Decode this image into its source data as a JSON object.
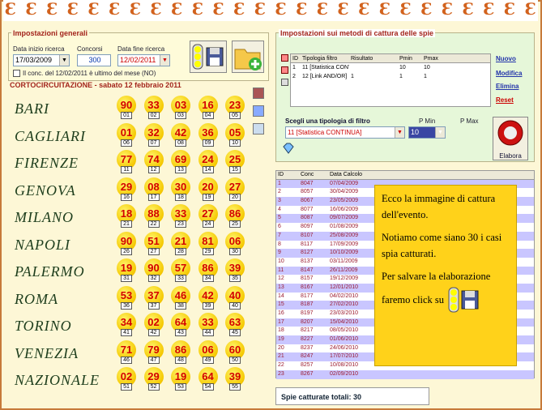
{
  "general": {
    "title": "Impostazioni generali",
    "start_label": "Data inizio ricerca",
    "start_value": "17/03/2009",
    "contests_label": "Concorsi",
    "contests_value": "300",
    "end_label": "Data fine ricerca",
    "end_value": "12/02/2011",
    "checkbox_label": "Il conc. del 12/02/2011 è ultimo del mese (NO)"
  },
  "lotto": {
    "title": "CORTOCIRCUITAZIONE - sabato 12 febbraio 2011",
    "rows": [
      {
        "city": "BARI",
        "nums": [
          "90",
          "33",
          "03",
          "16",
          "23"
        ],
        "idx": [
          "01",
          "02",
          "03",
          "04",
          "05"
        ]
      },
      {
        "city": "CAGLIARI",
        "nums": [
          "01",
          "32",
          "42",
          "36",
          "05"
        ],
        "idx": [
          "06",
          "07",
          "08",
          "09",
          "10"
        ]
      },
      {
        "city": "FIRENZE",
        "nums": [
          "77",
          "74",
          "69",
          "24",
          "25"
        ],
        "idx": [
          "11",
          "12",
          "13",
          "14",
          "15"
        ]
      },
      {
        "city": "GENOVA",
        "nums": [
          "29",
          "08",
          "30",
          "20",
          "27"
        ],
        "idx": [
          "16",
          "17",
          "18",
          "19",
          "20"
        ]
      },
      {
        "city": "MILANO",
        "nums": [
          "18",
          "88",
          "33",
          "27",
          "86"
        ],
        "idx": [
          "21",
          "22",
          "23",
          "24",
          "25"
        ]
      },
      {
        "city": "NAPOLI",
        "nums": [
          "90",
          "51",
          "21",
          "81",
          "06"
        ],
        "idx": [
          "26",
          "27",
          "28",
          "29",
          "30"
        ]
      },
      {
        "city": "PALERMO",
        "nums": [
          "19",
          "90",
          "57",
          "86",
          "39"
        ],
        "idx": [
          "31",
          "32",
          "33",
          "34",
          "35"
        ]
      },
      {
        "city": "ROMA",
        "nums": [
          "53",
          "37",
          "46",
          "42",
          "40"
        ],
        "idx": [
          "36",
          "37",
          "38",
          "39",
          "40"
        ]
      },
      {
        "city": "TORINO",
        "nums": [
          "34",
          "02",
          "64",
          "33",
          "63"
        ],
        "idx": [
          "41",
          "42",
          "43",
          "44",
          "45"
        ]
      },
      {
        "city": "VENEZIA",
        "nums": [
          "71",
          "79",
          "86",
          "06",
          "60"
        ],
        "idx": [
          "46",
          "47",
          "48",
          "49",
          "50"
        ]
      },
      {
        "city": "NAZIONALE",
        "nums": [
          "02",
          "29",
          "19",
          "64",
          "39"
        ],
        "idx": [
          "51",
          "52",
          "53",
          "54",
          "55"
        ]
      }
    ]
  },
  "spie": {
    "title": "Impostazioni sui metodi di cattura delle spie",
    "headers": [
      "ID",
      "Tipologia filtro",
      "Risultato",
      "Pmin",
      "Pmax"
    ],
    "rows": [
      [
        "1",
        "11 [Statistica CONTI...",
        "",
        "10",
        "10"
      ],
      [
        "2",
        "12 [Link AND/OR]",
        "1",
        "1",
        "1"
      ]
    ],
    "links": [
      "Nuovo",
      "Modifica",
      "Elimina",
      "Reset"
    ],
    "filter_label": "Scegli una tipologia di filtro",
    "pmin_label": "P Min",
    "pmax_label": "P Max",
    "filter_value": "11 [Statistica CONTINUA]",
    "pmin_value": "10",
    "elabora": "Elabora"
  },
  "results": {
    "headers": [
      "ID",
      "Conc",
      "Data Calcolo"
    ],
    "rows": [
      [
        "1",
        "8047",
        "07/04/2009"
      ],
      [
        "2",
        "8057",
        "30/04/2009"
      ],
      [
        "3",
        "8067",
        "23/05/2009"
      ],
      [
        "4",
        "8077",
        "16/06/2009"
      ],
      [
        "5",
        "8087",
        "09/07/2009"
      ],
      [
        "6",
        "8097",
        "01/08/2009"
      ],
      [
        "7",
        "8107",
        "25/08/2009"
      ],
      [
        "8",
        "8117",
        "17/09/2009"
      ],
      [
        "9",
        "8127",
        "10/10/2009"
      ],
      [
        "10",
        "8137",
        "03/11/2009"
      ],
      [
        "11",
        "8147",
        "26/11/2009"
      ],
      [
        "12",
        "8157",
        "19/12/2009"
      ],
      [
        "13",
        "8167",
        "12/01/2010"
      ],
      [
        "14",
        "8177",
        "04/02/2010"
      ],
      [
        "15",
        "8187",
        "27/02/2010"
      ],
      [
        "16",
        "8197",
        "23/03/2010"
      ],
      [
        "17",
        "8207",
        "15/04/2010"
      ],
      [
        "18",
        "8217",
        "08/05/2010"
      ],
      [
        "19",
        "8227",
        "01/06/2010"
      ],
      [
        "20",
        "8237",
        "24/06/2010"
      ],
      [
        "21",
        "8247",
        "17/07/2010"
      ],
      [
        "22",
        "8257",
        "10/08/2010"
      ],
      [
        "23",
        "8267",
        "02/09/2010"
      ]
    ],
    "total": "Spie catturate totali: 30"
  },
  "note": {
    "p1": "Ecco la immagine di cattura dell'evento.",
    "p2": "Notiamo come siano 30 i casi spia catturati.",
    "p3": "Per salvare la elaborazione faremo click su"
  }
}
